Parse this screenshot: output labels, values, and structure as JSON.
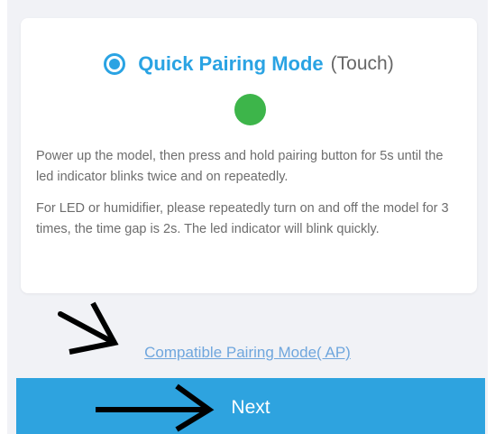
{
  "card": {
    "mode_title": "Quick Pairing Mode",
    "mode_subtitle": "(Touch)",
    "led_color": "#3db54a",
    "instructions": [
      "Power up the model, then press and hold pairing button for 5s until the led indicator blinks twice and on repeatedly.",
      "For LED or humidifier, please repeatedly turn on and off the model for 3 times, the time gap is 2s. The led indicator will blink quickly."
    ]
  },
  "link": {
    "label": "Compatible Pairing Mode( AP)"
  },
  "next_button": {
    "label": "Next"
  },
  "colors": {
    "accent": "#2aa3e3",
    "button": "#2ea3df",
    "link": "#6fa6dd",
    "background": "#f1f2f6"
  },
  "icons": [
    "radio-selected-icon",
    "arrow-right-icon"
  ]
}
